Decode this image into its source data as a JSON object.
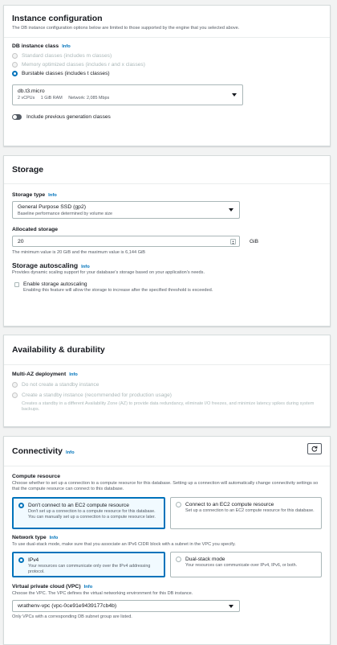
{
  "instance": {
    "title": "Instance configuration",
    "desc": "The DB instance configuration options below are limited to those supported by the engine that you selected above.",
    "class_label": "DB instance class",
    "info": "Info",
    "options": [
      "Standard classes (includes m classes)",
      "Memory optimized classes (includes r and x classes)",
      "Burstable classes (includes t classes)"
    ],
    "selected_index": 2,
    "select": {
      "value": "db.t3.micro",
      "meta": "2 vCPUs     1 GiB RAM     Network: 2,085 Mbps"
    },
    "toggle_label": "Include previous generation classes"
  },
  "storage": {
    "title": "Storage",
    "type_label": "Storage type",
    "info": "Info",
    "type_value": "General Purpose SSD (gp2)",
    "type_meta": "Baseline performance determined by volume size",
    "alloc_label": "Allocated storage",
    "alloc_value": "20",
    "alloc_unit": "GiB",
    "alloc_hint": "The minimum value is 20 GiB and the maximum value is 6,144 GiB",
    "autoscaling_title": "Storage autoscaling",
    "autoscaling_desc": "Provides dynamic scaling support for your database's storage based on your application's needs.",
    "autoscaling_check": "Enable storage autoscaling",
    "autoscaling_check_desc": "Enabling this feature will allow the storage to increase after the specified threshold is exceeded."
  },
  "availability": {
    "title": "Availability & durability",
    "multi_az_label": "Multi-AZ deployment",
    "info": "Info",
    "opt1": "Do not create a standby instance",
    "opt2": "Create a standby instance (recommended for production usage)",
    "opt2_desc": "Creates a standby in a different Availability Zone (AZ) to provide data redundancy, eliminate I/O freezes, and minimize latency spikes during system backups."
  },
  "connectivity": {
    "title": "Connectivity",
    "info": "Info",
    "compute_label": "Compute resource",
    "compute_desc": "Choose whether to set up a connection to a compute resource for this database. Setting up a connection will automatically change connectivity settings so that the compute resource can connect to this database.",
    "compute_opt1_title": "Don't connect to an EC2 compute resource",
    "compute_opt1_desc": "Don't set up a connection to a compute resource for this database. You can manually set up a connection to a compute resource later.",
    "compute_opt2_title": "Connect to an EC2 compute resource",
    "compute_opt2_desc": "Set up a connection to an EC2 compute resource for this database.",
    "network_label": "Network type",
    "network_desc": "To use dual-stack mode, make sure that you associate an IPv6 CIDR block with a subnet in the VPC you specify.",
    "net_opt1_title": "IPv4",
    "net_opt1_desc": "Your resources can communicate only over the IPv4 addressing protocol.",
    "net_opt2_title": "Dual-stack mode",
    "net_opt2_desc": "Your resources can communicate over IPv4, IPv6, or both.",
    "vpc_label": "Virtual private cloud (VPC)",
    "vpc_desc": "Choose the VPC. The VPC defines the virtual networking environment for this DB instance.",
    "vpc_value": "wrathenv-vpc (vpc-0ce91e9439177cb4b)",
    "vpc_hint": "Only VPCs with a corresponding DB subnet group are listed."
  },
  "colors": {
    "accent": "#0073bb",
    "background": "#f2f3f3",
    "panel": "#ffffff",
    "muted": "#545b64",
    "disabled": "#aab7b8"
  }
}
